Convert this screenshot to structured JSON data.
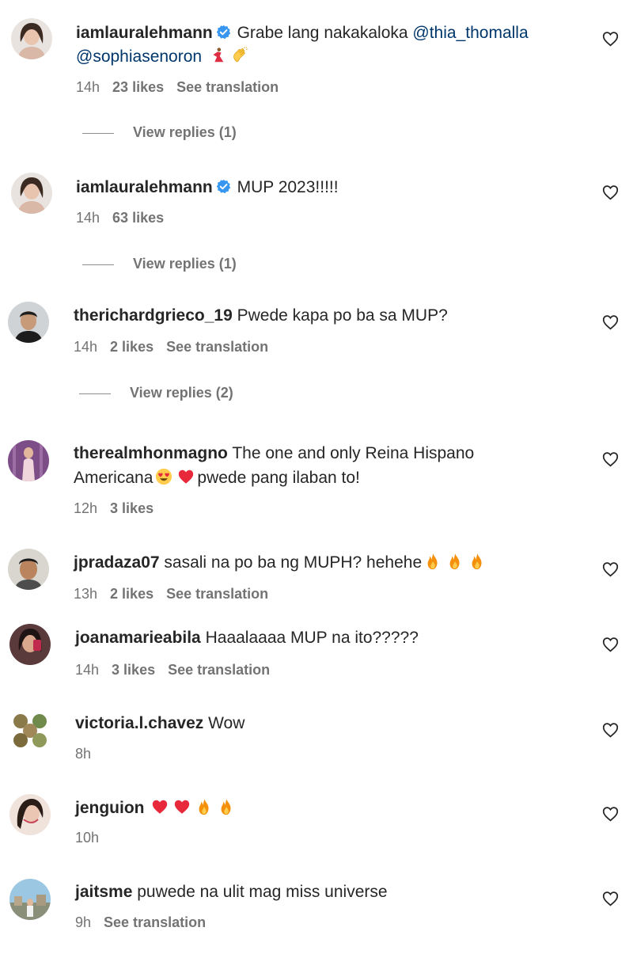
{
  "comments": [
    {
      "username": "iamlauralehmann",
      "verified": true,
      "text": "Grabe lang nakakaloka",
      "mention1": "@thia_thomalla",
      "mention2": "@sophiasenoron",
      "time": "14h",
      "likes": "23 likes",
      "translation": "See translation",
      "replies": "View replies (1)"
    },
    {
      "username": "iamlauralehmann",
      "verified": true,
      "text": "MUP 2023!!!!!",
      "time": "14h",
      "likes": "63 likes",
      "replies": "View replies (1)"
    },
    {
      "username": "therichardgrieco_19",
      "text": "Pwede kapa po ba sa MUP?",
      "time": "14h",
      "likes": "2 likes",
      "translation": "See translation",
      "replies": "View replies (2)"
    },
    {
      "username": "therealmhonmagno",
      "text": "The one and only Reina Hispano",
      "text2a": "Americana",
      "text2b": "pwede pang ilaban to!",
      "time": "12h",
      "likes": "3 likes"
    },
    {
      "username": "jpradaza07",
      "text": "sasali na po ba ng MUPH? hehehe",
      "time": "13h",
      "likes": "2 likes",
      "translation": "See translation"
    },
    {
      "username": "joanamarieabila",
      "text": "Haaalaaaa MUP na ito?????",
      "time": "14h",
      "likes": "3 likes",
      "translation": "See translation"
    },
    {
      "username": "victoria.l.chavez",
      "text": "Wow",
      "time": "8h"
    },
    {
      "username": "jenguion",
      "text": "",
      "time": "10h"
    },
    {
      "username": "jaitsme",
      "text": "puwede na ulit mag miss universe",
      "time": "9h",
      "translation": "See translation"
    }
  ],
  "colors": {
    "username": "#262626",
    "meta": "#737373",
    "mention": "#00376b",
    "verified": "#3797f0",
    "heart_emoji": "#e8293b",
    "fire_emoji": "#f4900c"
  },
  "icons": {
    "like": "heart-outline-icon",
    "verified": "verified-badge-icon"
  }
}
